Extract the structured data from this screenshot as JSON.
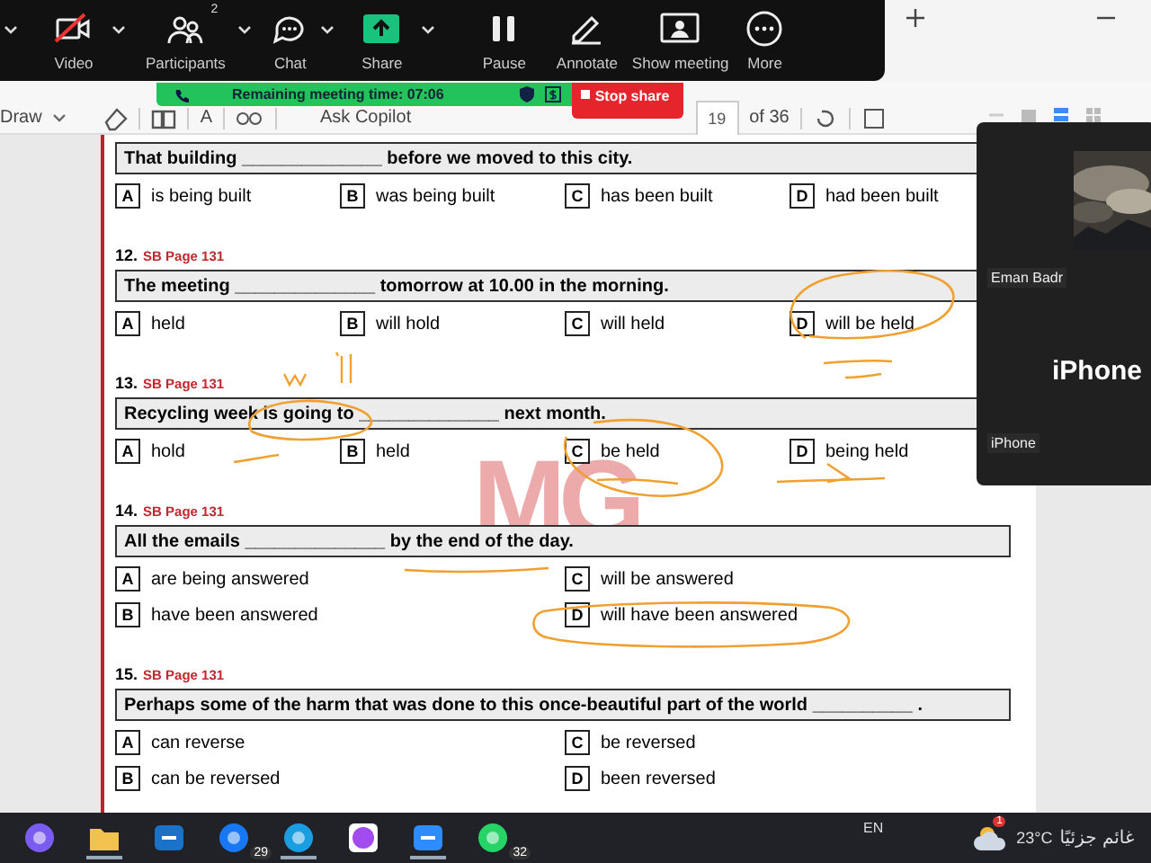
{
  "meeting_toolbar": {
    "items": [
      {
        "kind": "video",
        "label": "Video",
        "menu": true
      },
      {
        "kind": "participants",
        "label": "Participants",
        "badge": "2",
        "menu": true
      },
      {
        "kind": "chat",
        "label": "Chat",
        "menu": true
      },
      {
        "kind": "share",
        "label": "Share",
        "menu": true
      },
      {
        "kind": "pause",
        "label": "Pause",
        "menu": false
      },
      {
        "kind": "annotate",
        "label": "Annotate",
        "menu": false
      },
      {
        "kind": "show",
        "label": "Show meeting",
        "menu": false
      },
      {
        "kind": "more",
        "label": "More",
        "menu": false
      }
    ]
  },
  "meeting_banner": {
    "remaining": "Remaining meeting time: 07:06",
    "stop": "Stop share"
  },
  "pdf_toolbar": {
    "draw": "Draw",
    "font_size": "A",
    "ask": "Ask Copilot",
    "page": "19",
    "total": "of 36"
  },
  "document": {
    "logo": "MG",
    "questions": [
      {
        "stem": "That building ______________ before we moved to this city.",
        "option_rows": [
          [
            {
              "letter": "A",
              "text": "is being built"
            },
            {
              "letter": "B",
              "text": "was being built"
            },
            {
              "letter": "C",
              "text": "has been built"
            },
            {
              "letter": "D",
              "text": "had been built"
            }
          ]
        ]
      },
      {
        "number": "12.",
        "source": "SB Page 131",
        "stem": "The meeting ______________ tomorrow at 10.00 in the morning.",
        "option_rows": [
          [
            {
              "letter": "A",
              "text": "held"
            },
            {
              "letter": "B",
              "text": "will hold"
            },
            {
              "letter": "C",
              "text": "will held"
            },
            {
              "letter": "D",
              "text": "will be held"
            }
          ]
        ]
      },
      {
        "number": "13.",
        "source": "SB Page 131",
        "stem": "Recycling week is going to ______________  next month.",
        "option_rows": [
          [
            {
              "letter": "A",
              "text": "hold"
            },
            {
              "letter": "B",
              "text": "held"
            },
            {
              "letter": "C",
              "text": "be held"
            },
            {
              "letter": "D",
              "text": "being held"
            }
          ]
        ]
      },
      {
        "number": "14.",
        "source": "SB Page 131",
        "stem": "All the emails ______________  by the end of the day.",
        "option_rows": [
          [
            {
              "letter": "A",
              "text": "are being answered"
            },
            {
              "letter": "C",
              "text": "will be answered"
            }
          ],
          [
            {
              "letter": "B",
              "text": "have been answered"
            },
            {
              "letter": "D",
              "text": "will have been answered"
            }
          ]
        ]
      },
      {
        "number": "15.",
        "source": "SB Page 131",
        "stem": "Perhaps some of the harm that was done to this once-beautiful part of the world __________ .",
        "option_rows": [
          [
            {
              "letter": "A",
              "text": "can reverse"
            },
            {
              "letter": "C",
              "text": "be reversed"
            }
          ],
          [
            {
              "letter": "B",
              "text": "can be reversed"
            },
            {
              "letter": "D",
              "text": "been reversed"
            }
          ]
        ]
      }
    ]
  },
  "video_panel": {
    "tiles": [
      {
        "kind": "picture",
        "name": "Eman Badr"
      },
      {
        "kind": "device",
        "name": "iPhone",
        "title": "iPhone"
      }
    ]
  },
  "taskbar": {
    "apps": [
      {
        "kind": "copilot",
        "running": false
      },
      {
        "kind": "folder",
        "running": true
      },
      {
        "kind": "outlook",
        "running": false
      },
      {
        "kind": "facebook",
        "badge": "29",
        "running": false
      },
      {
        "kind": "edge",
        "running": true
      },
      {
        "kind": "messenger",
        "running": false
      },
      {
        "kind": "zoom",
        "running": true
      },
      {
        "kind": "whatsapp",
        "badge": "32",
        "running": false
      }
    ],
    "language": "EN",
    "weather_badge": "1",
    "temperature": "23°C",
    "weather": "غائم جزئيًا"
  }
}
